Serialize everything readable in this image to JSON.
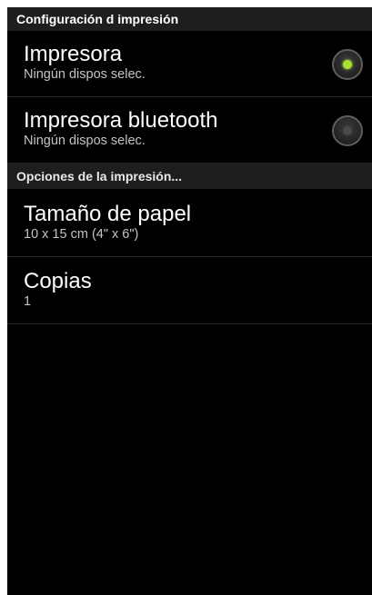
{
  "print_setup": {
    "header": "Configuración d impresión",
    "printers": [
      {
        "title": "Impresora",
        "subtitle": "Ningún dispos selec.",
        "selected": true
      },
      {
        "title": "Impresora bluetooth",
        "subtitle": "Ningún dispos selec.",
        "selected": false
      }
    ]
  },
  "print_options": {
    "header": "Opciones de la impresión...",
    "paper_size": {
      "title": "Tamaño de papel",
      "value": "10 x 15 cm (4\" x 6\")"
    },
    "copies": {
      "title": "Copias",
      "value": "1"
    }
  },
  "colors": {
    "background": "#000000",
    "header_background": "#1e1e1e",
    "radio_checked": "#a6e22e"
  }
}
